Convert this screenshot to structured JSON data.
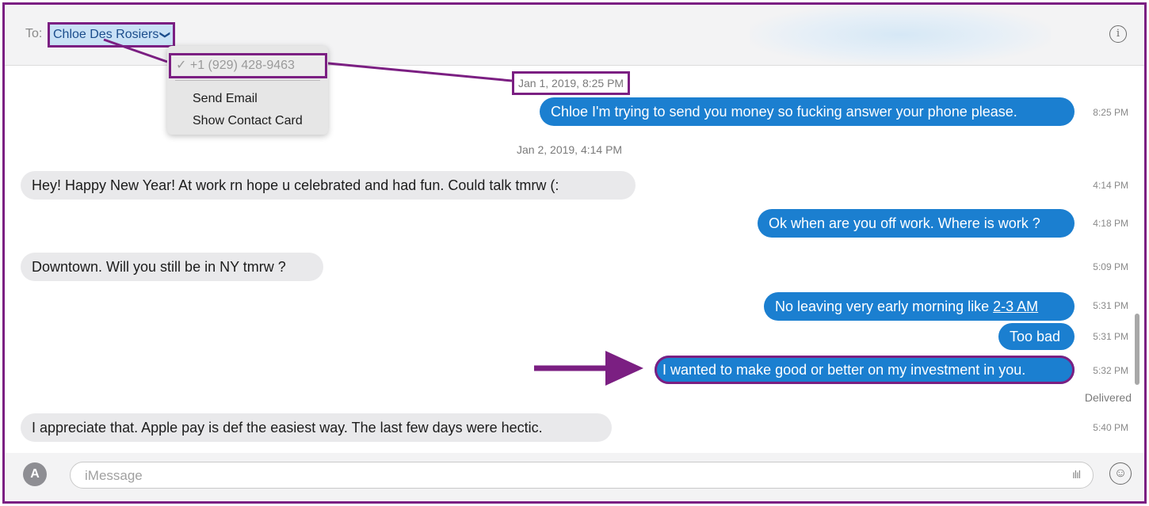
{
  "header": {
    "to_label": "To:",
    "recipient": "Chloe Des Rosiers",
    "chevron_glyph": "❯",
    "info_glyph": "i"
  },
  "dropdown": {
    "selected": "✓ +1 (929) 428-9463",
    "items": [
      "Send Email",
      "Show Contact Card"
    ]
  },
  "conversation": {
    "date_1": {
      "date": "Jan 1, 2019,",
      "time": "8:25 PM"
    },
    "date_2": "Jan 2, 2019, 4:14 PM",
    "messages": [
      {
        "direction": "sent",
        "text": "Chloe I'm trying to send you money so fucking answer your phone please.",
        "time": "8:25 PM"
      },
      {
        "direction": "received",
        "text": "Hey! Happy New Year! At work rn hope u celebrated and had fun. Could talk tmrw (:",
        "time": "4:14 PM"
      },
      {
        "direction": "sent",
        "text": "Ok when are you off work. Where is work ?",
        "time": "4:18 PM"
      },
      {
        "direction": "received",
        "text": "Downtown. Will you still be in NY tmrw ?",
        "time": "5:09 PM"
      },
      {
        "direction": "sent",
        "text": "No leaving very early morning like ",
        "link": "2-3 AM",
        "time": "5:31 PM"
      },
      {
        "direction": "sent",
        "text": "Too bad",
        "time": "5:31 PM"
      },
      {
        "direction": "sent",
        "text": "I wanted to make good or better on my investment in you.",
        "time": "5:32 PM"
      },
      {
        "direction": "received",
        "text": "I appreciate that. Apple pay is def the easiest way. The last few days were hectic.",
        "time": "5:40 PM"
      }
    ],
    "delivered_label": "Delivered"
  },
  "input": {
    "placeholder": "iMessage",
    "apps_glyph": "A",
    "audio_glyph": "ılıl",
    "emoji_glyph": "☺"
  },
  "colors": {
    "annotation": "#7b1f82",
    "sent_bubble": "#1b7fd0",
    "received_bubble": "#e9e9eb"
  }
}
